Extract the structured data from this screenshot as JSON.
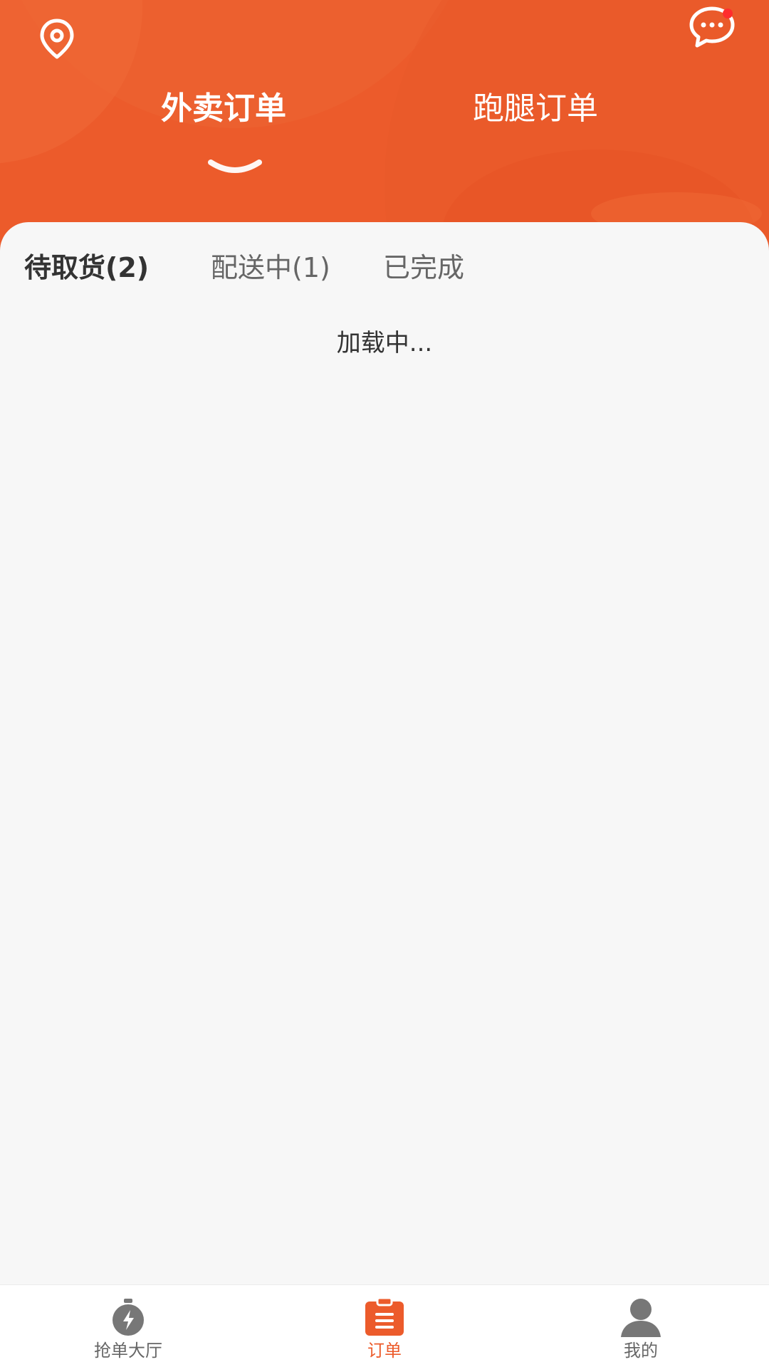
{
  "header": {
    "tabs": [
      {
        "label": "外卖订单",
        "active": true
      },
      {
        "label": "跑腿订单",
        "active": false
      }
    ],
    "left_icon": "location-pin-icon",
    "right_icon": "message-bubble-icon",
    "has_unread_message": true
  },
  "order_tabs": [
    {
      "label": "待取货(2)",
      "active": true
    },
    {
      "label": "配送中(1)",
      "active": false
    },
    {
      "label": "已完成",
      "active": false
    }
  ],
  "status": {
    "loading_text": "加载中..."
  },
  "bottom_nav": {
    "items": [
      {
        "label": "抢单大厅",
        "icon": "grab-order-icon",
        "active": false
      },
      {
        "label": "订单",
        "icon": "order-list-icon",
        "active": true
      },
      {
        "label": "我的",
        "icon": "profile-icon",
        "active": false
      }
    ]
  },
  "colors": {
    "brand": "#ec5b2b",
    "background": "#f7f7f7",
    "text_primary": "#333333",
    "text_secondary": "#666666",
    "unread_dot": "#ff2d2d"
  }
}
